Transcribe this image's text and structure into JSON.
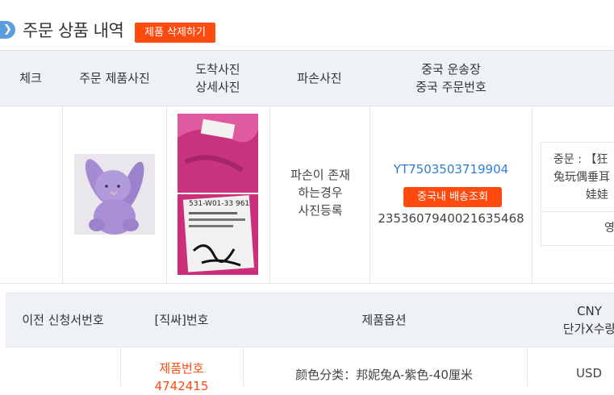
{
  "header": {
    "icon": "chevron-right-icon",
    "title": "주문 상품 내역",
    "delete_label": "제품 삭제하기"
  },
  "table1": {
    "columns": {
      "check": "체크",
      "product_photo": "주문 제품사진",
      "arrival_line1": "도착사진",
      "arrival_line2": "상세사진",
      "damage_photo": "파손사진",
      "shipping_line1": "중국 운송장",
      "shipping_line2": "중국 주문번호"
    },
    "row": {
      "damage_line1": "파손이 존재",
      "damage_line2": "하는경우",
      "damage_line3": "사진등록",
      "tracking_number": "YT7503503719904",
      "tracking_button": "중국내 배송조회",
      "order_number": "2353607940021635468",
      "note_line1": "중문 : 【狂",
      "note_line2": "兔玩偶垂耳",
      "note_line3": "娃娃",
      "note_sub": "영"
    }
  },
  "table2": {
    "columns": {
      "prev_app": "이전 신청서번호",
      "direct_no": "[직싸]번호",
      "options": "제품옵션",
      "cny_line1": "CNY",
      "cny_line2": "단가X수량"
    },
    "row": {
      "product_label": "제품번호",
      "product_number": "4742415",
      "option_text": "颜色分类：邦妮兔A-紫色-40厘米",
      "currency": "USD"
    }
  },
  "colors": {
    "accent_orange": "#ff4b10",
    "link_blue": "#2f7dd1",
    "header_bg": "#eef2f7"
  }
}
